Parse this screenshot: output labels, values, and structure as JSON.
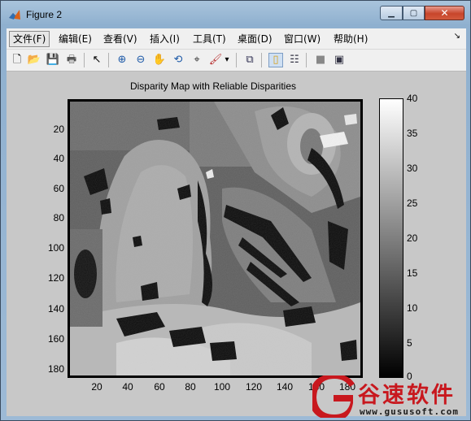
{
  "window": {
    "title": "Figure 2",
    "close_label": "✕",
    "max_label": "▢",
    "min_label": "▁"
  },
  "menu": {
    "items": [
      "文件(F)",
      "编辑(E)",
      "查看(V)",
      "插入(I)",
      "工具(T)",
      "桌面(D)",
      "窗口(W)",
      "帮助(H)"
    ],
    "overflow": "↘"
  },
  "toolbar": {
    "buttons": [
      "new-figure-icon",
      "open-file-icon",
      "save-icon",
      "print-icon",
      "pointer-icon",
      "zoom-in-icon",
      "zoom-out-icon",
      "pan-hand-icon",
      "rotate-3d-icon",
      "data-cursor-icon",
      "brush-icon",
      "link-plot-icon",
      "colorbar-icon",
      "legend-icon",
      "hide-tools-icon",
      "show-tools-icon"
    ],
    "glyphs": {
      "new": "🗋",
      "open": "📂",
      "save": "💾",
      "print": "🖶",
      "pointer": "↖",
      "zoom_in": "⊕",
      "zoom_out": "⊖",
      "pan": "✋",
      "rotate": "⟲",
      "cursor": "⌖",
      "brush": "🖌",
      "brush_menu": "▾",
      "link": "⧉",
      "colorbar": "▯",
      "legend": "☷",
      "hide": "■",
      "show": "▣"
    }
  },
  "figure": {
    "title": "Disparity Map with Reliable Disparities",
    "y_ticks": [
      "20",
      "40",
      "60",
      "80",
      "100",
      "120",
      "140",
      "160",
      "180"
    ],
    "x_ticks": [
      "20",
      "40",
      "60",
      "80",
      "100",
      "120",
      "140",
      "160",
      "180"
    ],
    "colorbar_ticks": [
      "40",
      "35",
      "30",
      "25",
      "20",
      "15",
      "10",
      "5",
      "0"
    ],
    "colormap": "gray"
  },
  "watermark": {
    "brand": "谷速软件",
    "url": "www.gususoft.com",
    "logo_color": "#c8181e"
  }
}
